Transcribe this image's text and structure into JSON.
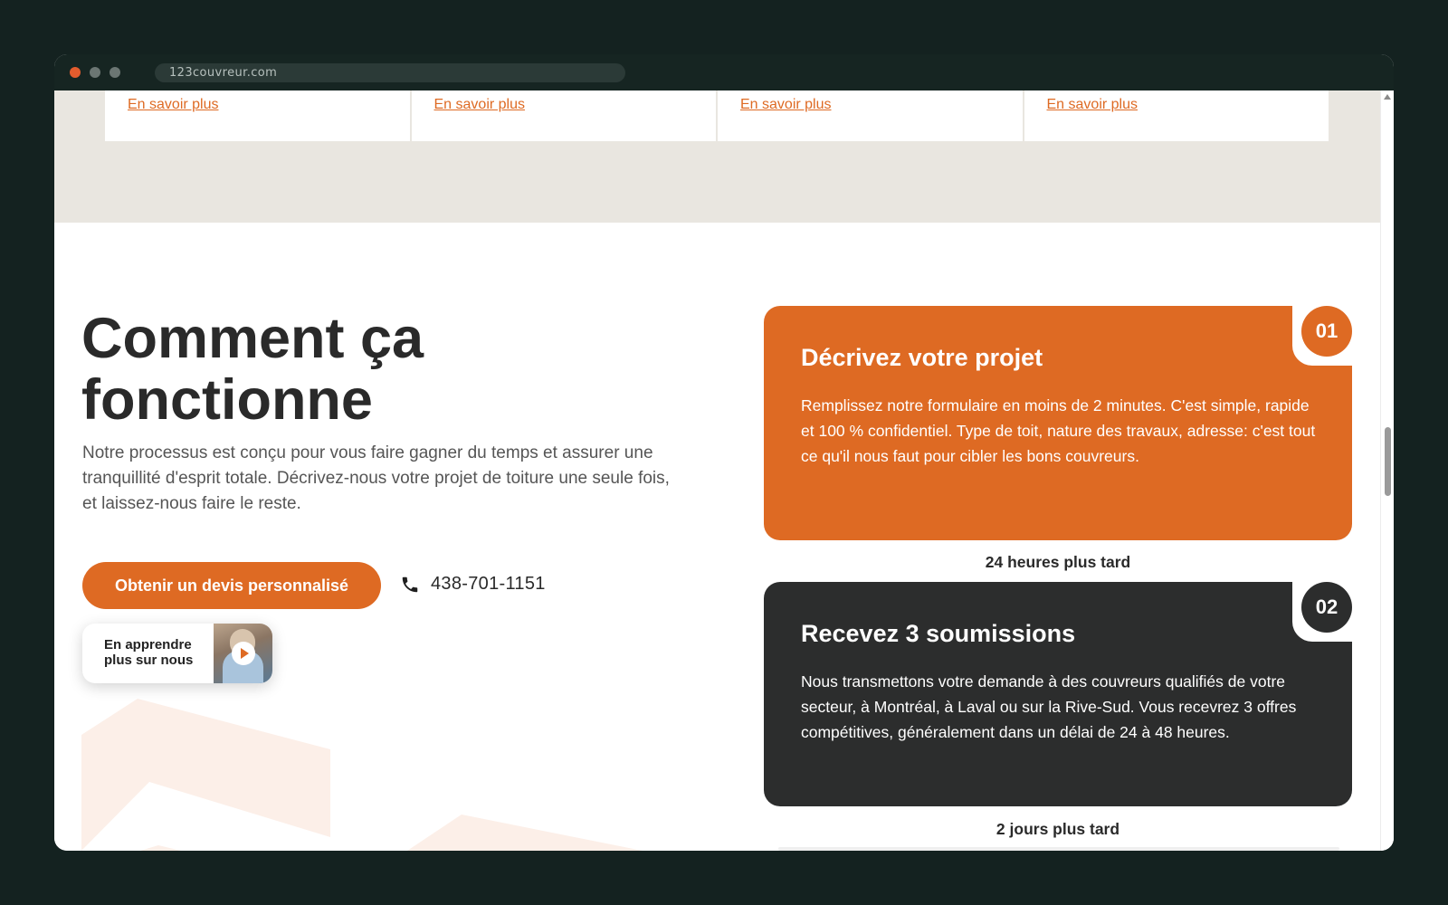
{
  "browser": {
    "url": "123couvreur.com"
  },
  "services_strip": {
    "links": [
      "En savoir plus",
      "En savoir plus",
      "En savoir plus",
      "En savoir plus"
    ]
  },
  "how_it_works": {
    "title_line1": "Comment ça",
    "title_line2": "fonctionne",
    "intro": "Notre processus est conçu pour vous faire gagner du temps et assurer une tranquillité d'esprit totale. Décrivez-nous votre projet de toiture une seule fois, et laissez-nous faire le reste.",
    "cta_label": "Obtenir un devis personnalisé",
    "phone": "438-701-1151",
    "video_label": "En apprendre plus sur nous"
  },
  "steps": [
    {
      "number": "01",
      "title": "Décrivez votre projet",
      "text": "Remplissez notre formulaire en moins de 2 minutes. C'est simple, rapide et 100 % confidentiel. Type de toit, nature des travaux, adresse: c'est tout ce qu'il nous faut pour cibler les bons couvreurs.",
      "delay_after": "24 heures plus tard"
    },
    {
      "number": "02",
      "title": "Recevez 3 soumissions",
      "text": "Nous transmettons votre demande à des couvreurs qualifiés de votre secteur, à Montréal, à Laval ou sur la Rive-Sud. Vous recevrez 3 offres compétitives, généralement dans un délai de 24 à 48 heures.",
      "delay_after": "2 jours plus tard"
    }
  ],
  "colors": {
    "accent": "#de6a23",
    "dark_card": "#2c2d2d",
    "beige_band": "#e9e6e0",
    "window_bg": "#142220"
  }
}
